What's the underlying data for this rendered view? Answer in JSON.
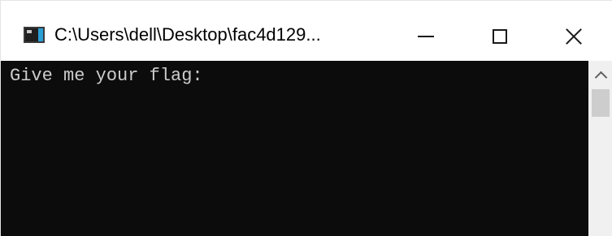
{
  "window": {
    "title": "C:\\Users\\dell\\Desktop\\fac4d129..."
  },
  "titlebar": {
    "app_icon": "console-app-icon",
    "minimize_icon": "minimize-icon",
    "maximize_icon": "maximize-icon",
    "close_icon": "close-icon"
  },
  "console": {
    "prompt_line": "Give me your flag:",
    "background": "#0c0c0c",
    "text_color": "#cccccc"
  },
  "scrollbar": {
    "up_arrow_icon": "chevron-up-icon"
  }
}
